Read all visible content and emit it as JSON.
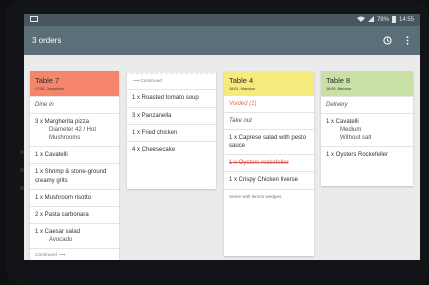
{
  "colors": {
    "appbar": "#5b6f79",
    "statusbar": "#48565d",
    "table7_header": "#f5866b",
    "table4_header": "#f5ea7c",
    "table8_header": "#c9e0a6",
    "voided_text": "#e06b59"
  },
  "status_bar": {
    "battery": "78%",
    "time": "14:55"
  },
  "app_bar": {
    "title": "3 orders",
    "icons": [
      "clock-icon",
      "more-vert-icon"
    ]
  },
  "orders": [
    {
      "title": "Table 7",
      "subtitle": "17:56, Josephine",
      "rows": [
        {
          "kind": "italic",
          "text": "Dine in"
        },
        {
          "kind": "item",
          "text": "3 x Margherita pizza",
          "mods": [
            "Diameter 42 / Hot",
            "Mushrooms"
          ]
        },
        {
          "kind": "item",
          "text": "1 x Cavatelli"
        },
        {
          "kind": "item",
          "text": "1 x Shrimp & stone-ground creamy grits"
        },
        {
          "kind": "item",
          "text": "1 x Mushroom risotto"
        },
        {
          "kind": "item",
          "text": "2 x Pasta carbonara"
        },
        {
          "kind": "item",
          "text": "1 x Caesar salad",
          "mods": [
            "Avocado"
          ]
        },
        {
          "kind": "continued",
          "text": "Continued ⟶"
        }
      ]
    },
    {
      "title": "",
      "subtitle": "",
      "rows": [
        {
          "kind": "continued",
          "text": "⟶ Continued"
        },
        {
          "kind": "item",
          "text": "1 x Roasted tomato soup"
        },
        {
          "kind": "item",
          "text": "3 x Panzanella"
        },
        {
          "kind": "item",
          "text": "1 x Fried chicken"
        },
        {
          "kind": "item",
          "text": "4 x Cheesecake"
        }
      ]
    },
    {
      "title": "Table 4",
      "subtitle": "18:01, Manolos",
      "rows": [
        {
          "kind": "voided",
          "text": "Voided (1)"
        },
        {
          "kind": "italic",
          "text": "Take out"
        },
        {
          "kind": "item",
          "text": "1 x Caprese salad with pesto sauce"
        },
        {
          "kind": "strike",
          "text": "1 x Oysters rockefeller"
        },
        {
          "kind": "item",
          "text": "1 x Crispy Chicken liverse"
        },
        {
          "kind": "note",
          "text": "Serve with lemon wedges"
        }
      ]
    },
    {
      "title": "Table 8",
      "subtitle": "18:06, Barbara",
      "rows": [
        {
          "kind": "italic",
          "text": "Delivery"
        },
        {
          "kind": "item",
          "text": "1 x Cavatelli",
          "mods": [
            "Medium",
            "Without salt"
          ]
        },
        {
          "kind": "item",
          "text": "1 x Oysters Rockefeller"
        }
      ]
    }
  ]
}
